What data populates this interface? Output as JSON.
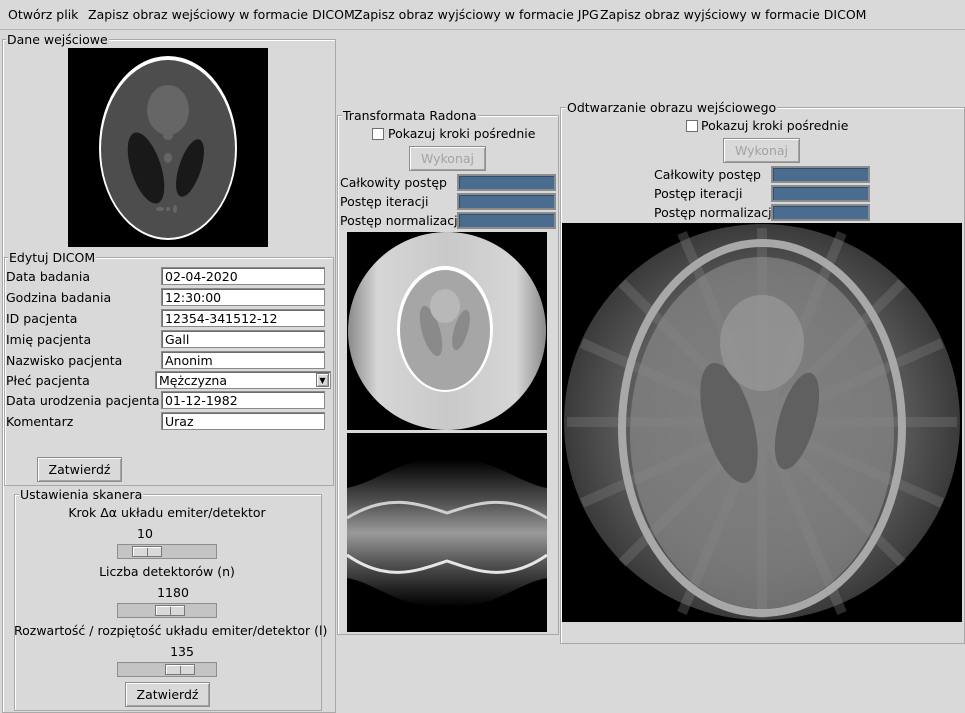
{
  "menu": {
    "open_file": "Otwórz plik",
    "save_input_dicom": "Zapisz obraz wejściowy w formacie DICOM",
    "save_output_jpg": "Zapisz obraz wyjściowy w formacie JPG",
    "save_output_dicom": "Zapisz obraz wyjściowy w formacie DICOM"
  },
  "input_data": {
    "title": "Dane wejściowe"
  },
  "edit_dicom": {
    "title": "Edytuj DICOM",
    "fields": [
      {
        "label": "Data badania",
        "value": "02-04-2020"
      },
      {
        "label": "Godzina badania",
        "value": "12:30:00"
      },
      {
        "label": "ID pacjenta",
        "value": "12354-341512-12"
      },
      {
        "label": "Imię pacjenta",
        "value": "Gall"
      },
      {
        "label": "Nazwisko pacjenta",
        "value": "Anonim"
      },
      {
        "label": "Płeć pacjenta",
        "value": "Mężczyzna"
      },
      {
        "label": "Data urodzenia pacjenta",
        "value": "01-12-1982"
      },
      {
        "label": "Komentarz",
        "value": "Uraz"
      }
    ],
    "confirm_label": "Zatwierdź"
  },
  "scanner": {
    "title": "Ustawienia skanera",
    "step_label": "Krok Δα układu emiter/detektor",
    "step_value": "10",
    "step_fraction": 0.2,
    "detectors_label": "Liczba detektorów (n)",
    "detectors_value": "1180",
    "detectors_fraction": 0.55,
    "spread_label": "Rozwartość / rozpiętość układu emiter/detektor (l)",
    "spread_value": "135",
    "spread_fraction": 0.7,
    "confirm_label": "Zatwierdź"
  },
  "radon": {
    "title": "Transformata Radona",
    "show_steps_label": "Pokazuj kroki pośrednie",
    "show_steps_checked": false,
    "execute_label": "Wykonaj",
    "total_progress_label": "Całkowity postęp",
    "iteration_progress_label": "Postęp iteracji",
    "normalization_progress_label": "Postęp normalizacji",
    "total_progress": 1.0,
    "iteration_progress": 1.0,
    "normalization_progress": 1.0
  },
  "reconstruction": {
    "title": "Odtwarzanie obrazu wejściowego",
    "show_steps_label": "Pokazuj kroki pośrednie",
    "show_steps_checked": false,
    "execute_label": "Wykonaj",
    "total_progress_label": "Całkowity postęp",
    "iteration_progress_label": "Postęp iteracji",
    "normalization_progress_label": "Postęp normalizacji",
    "total_progress": 1.0,
    "iteration_progress": 1.0,
    "normalization_progress": 1.0
  },
  "icons": {
    "dropdown": "chevron-down-icon"
  }
}
